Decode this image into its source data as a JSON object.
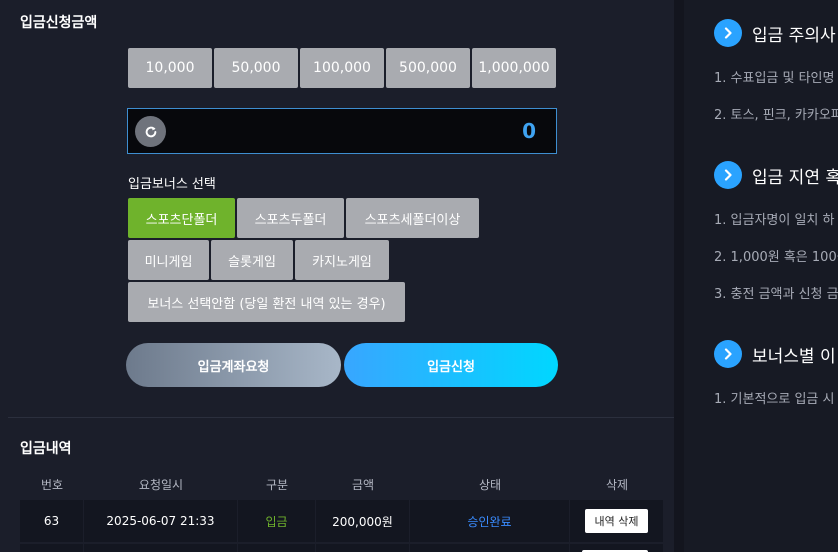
{
  "deposit": {
    "title": "입금신청금액",
    "amount_buttons": [
      "10,000",
      "50,000",
      "100,000",
      "500,000",
      "1,000,000"
    ],
    "amount_value": "0",
    "bonus_label": "입금보너스 선택",
    "bonus_options": [
      "스포츠단폴더",
      "스포츠두폴더",
      "스포츠세폴더이상",
      "미니게임",
      "슬롯게임",
      "카지노게임",
      "보너스 선택안함 (당일 환전 내역 있는 경우)"
    ],
    "selected_bonus": "스포츠단폴더",
    "request_account_label": "입금계좌요청",
    "request_deposit_label": "입금신청"
  },
  "history": {
    "title": "입금내역",
    "columns": [
      "번호",
      "요청일시",
      "구분",
      "금액",
      "상태",
      "삭제"
    ],
    "rows": [
      {
        "no": "63",
        "datetime": "2025-06-07 21:33",
        "type": "입금",
        "amount": "200,000원",
        "status": "승인완료",
        "delete_label": "내역 삭제"
      }
    ]
  },
  "notices": {
    "sections": [
      {
        "title": "입금 주의사",
        "items": [
          "1. 수표입금 및 타인명",
          "2. 토스, 핀크, 카카오퍼"
        ]
      },
      {
        "title": "입금 지연 혹",
        "items": [
          "1. 입금자명이 일치 하",
          "2. 1,000원 혹은 100원",
          "3. 충전 금액과 신청 금"
        ]
      },
      {
        "title": "보너스별 이",
        "items": [
          "1. 기본적으로 입금 시"
        ]
      }
    ]
  },
  "colors": {
    "active_bonus": "#6fb32c",
    "accent_blue": "#3fa3f2",
    "status_blue": "#3a8cff"
  }
}
